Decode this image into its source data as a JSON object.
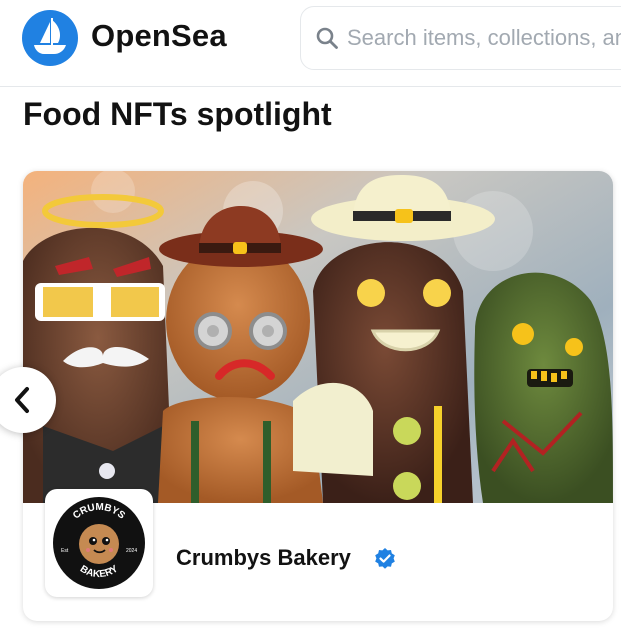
{
  "header": {
    "brand": "OpenSea",
    "logo_icon": "opensea-logo-icon",
    "search": {
      "placeholder": "Search items, collections, and accounts",
      "icon": "search-icon"
    }
  },
  "section": {
    "title": "Food NFTs spotlight"
  },
  "card": {
    "collection_name": "Crumbys Bakery",
    "verified": true,
    "verified_icon": "verified-badge-icon",
    "avatar": {
      "logo_text_top": "CRUMBYS",
      "logo_text_bottom": "BAKERY",
      "est_label": "Est",
      "year": "2024"
    }
  },
  "carousel": {
    "prev_icon": "chevron-left-icon"
  },
  "colors": {
    "brand_blue": "#2081e2",
    "text": "#121212",
    "placeholder": "#a2a9b1",
    "border": "#e5e8eb"
  }
}
